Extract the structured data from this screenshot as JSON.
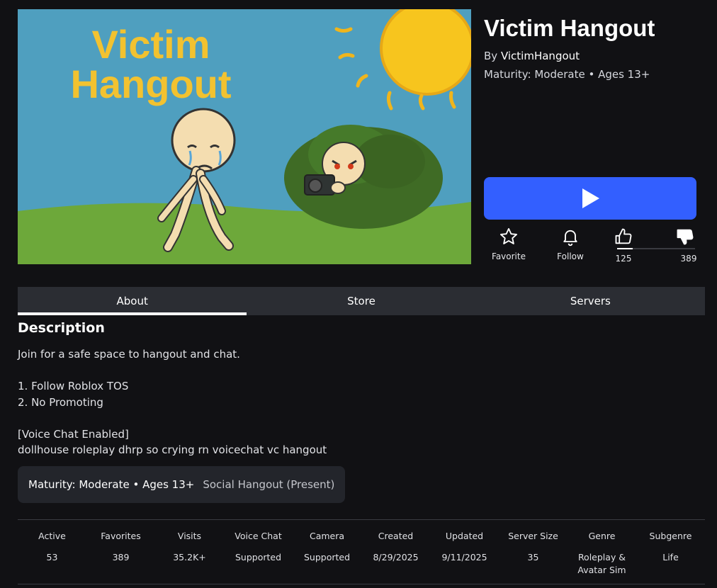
{
  "thumbnail": {
    "title_line1": "Victim",
    "title_line2": "Hangout"
  },
  "game": {
    "title": "Victim Hangout",
    "by_prefix": "By",
    "creator": "VictimHangout",
    "maturity": "Maturity: Moderate • Ages 13+"
  },
  "actions": {
    "favorite_label": "Favorite",
    "follow_label": "Follow",
    "upvotes": "125",
    "downvotes": "389"
  },
  "colors": {
    "play_button": "#335fff",
    "background": "#111114",
    "tab_bar": "#2b2d33"
  },
  "tabs": [
    {
      "label": "About",
      "active": true
    },
    {
      "label": "Store",
      "active": false
    },
    {
      "label": "Servers",
      "active": false
    }
  ],
  "description": {
    "heading": "Description",
    "body": "Join for a safe space to hangout and chat.\n\n1. Follow Roblox TOS\n2. No Promoting\n\n[Voice Chat Enabled]\ndollhouse roleplay dhrp so crying rn voicechat vc hangout"
  },
  "tags": {
    "maturity": "Maturity: Moderate • Ages 13+",
    "genre": "Social Hangout (Present)"
  },
  "stats": [
    {
      "label": "Active",
      "value": "53"
    },
    {
      "label": "Favorites",
      "value": "389"
    },
    {
      "label": "Visits",
      "value": "35.2K+"
    },
    {
      "label": "Voice Chat",
      "value": "Supported"
    },
    {
      "label": "Camera",
      "value": "Supported"
    },
    {
      "label": "Created",
      "value": "8/29/2025"
    },
    {
      "label": "Updated",
      "value": "9/11/2025"
    },
    {
      "label": "Server Size",
      "value": "35"
    },
    {
      "label": "Genre",
      "value": "Roleplay & Avatar Sim"
    },
    {
      "label": "Subgenre",
      "value": "Life"
    }
  ]
}
